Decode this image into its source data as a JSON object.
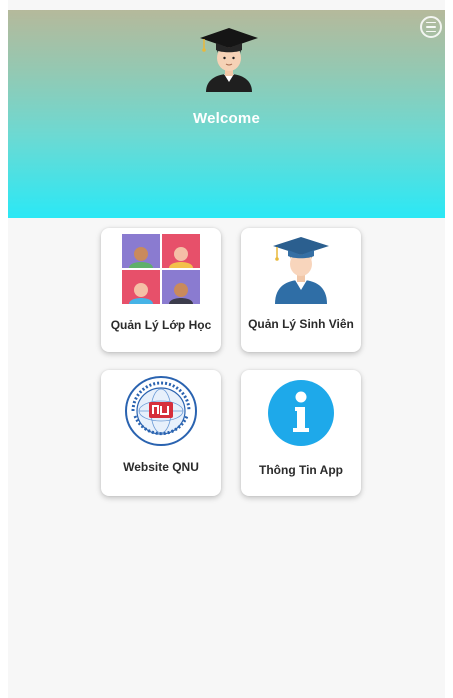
{
  "header": {
    "welcome_text": "Welcome",
    "avatar_icon": "graduate-avatar-icon",
    "menu_icon": "menu-icon"
  },
  "menu": [
    {
      "label": "Quản Lý Lớp Học",
      "icon": "classroom-icon"
    },
    {
      "label": "Quản Lý Sinh Viên",
      "icon": "student-icon"
    },
    {
      "label": "Website QNU",
      "icon": "qnu-logo-icon"
    },
    {
      "label": "Thông Tin App",
      "icon": "info-icon"
    }
  ],
  "colors": {
    "header_top": "#b5b99b",
    "header_bottom": "#2be8f5",
    "info_blue": "#1ea9ea",
    "background": "#f7f7f7"
  }
}
